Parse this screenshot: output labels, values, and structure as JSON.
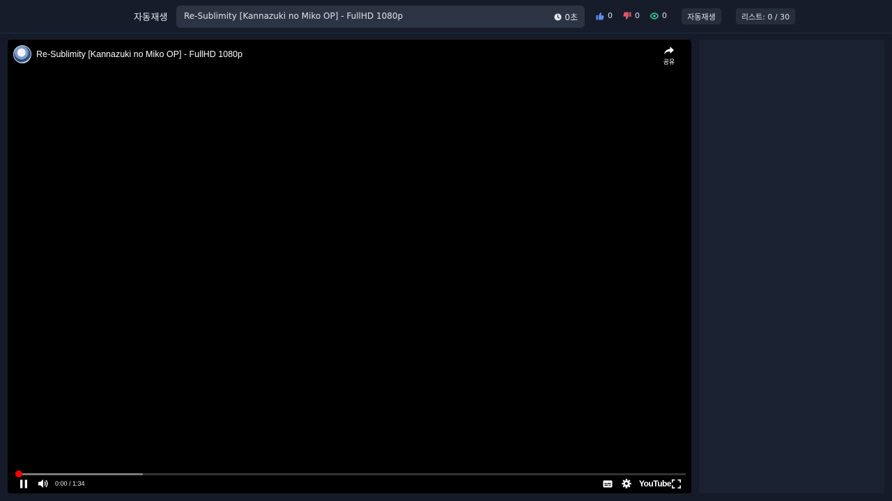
{
  "header": {
    "app_label": "자동재생",
    "now_playing_title": "Re-Sublimity [Kannazuki no Miko OP] - FullHD 1080p",
    "now_playing_time": "0초",
    "likes": "0",
    "dislikes": "0",
    "views": "0",
    "autoplay_button_label": "자동재생",
    "list_button_label": "리스트: 0 / 30"
  },
  "player": {
    "video_title": "Re-Sublimity [Kannazuki no Miko OP] - FullHD 1080p",
    "share_label": "공유",
    "time_readout": "0:00 / 1:34",
    "played_fraction": 0.005,
    "buffered_fraction": 0.19,
    "logo_text": "YouTube",
    "icons": [
      "pause-icon",
      "volume-icon",
      "subtitles-icon",
      "settings-icon",
      "fullscreen-icon",
      "share-icon"
    ]
  },
  "colors": {
    "like_icon": "#5b8def",
    "dislike_icon": "#e0566a",
    "view_icon": "#34d399",
    "progress": "#ff0000"
  }
}
